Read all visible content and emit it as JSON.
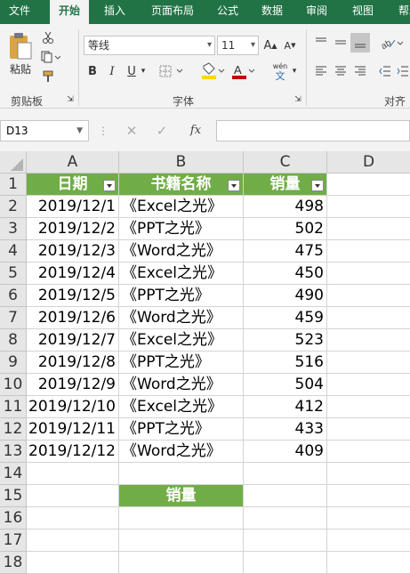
{
  "ribbon": {
    "tabs": [
      "文件",
      "开始",
      "插入",
      "页面布局",
      "公式",
      "数据",
      "审阅",
      "视图",
      "帮助"
    ],
    "active_tab": "开始",
    "clipboard": {
      "paste_label": "粘贴",
      "group_label": "剪贴板"
    },
    "font": {
      "name": "等线",
      "size": "11",
      "group_label": "字体",
      "grow": "A",
      "shrink": "A",
      "bold": "B",
      "italic": "I",
      "underline": "U",
      "wen": "wén",
      "wen2": "文"
    },
    "align": {
      "group_label": "对齐方"
    }
  },
  "formula_bar": {
    "name_box": "D13",
    "fx": "fx",
    "formula": ""
  },
  "columns": [
    "A",
    "B",
    "C",
    "D"
  ],
  "rows": [
    "1",
    "2",
    "3",
    "4",
    "5",
    "6",
    "7",
    "8",
    "9",
    "10",
    "11",
    "12",
    "13",
    "14",
    "15",
    "16",
    "17",
    "18"
  ],
  "table": {
    "headers": [
      "日期",
      "书籍名称",
      "销量"
    ],
    "rows": [
      [
        "2019/12/1",
        "《Excel之光》",
        "498"
      ],
      [
        "2019/12/2",
        "《PPT之光》",
        "502"
      ],
      [
        "2019/12/3",
        "《Word之光》",
        "475"
      ],
      [
        "2019/12/4",
        "《Excel之光》",
        "450"
      ],
      [
        "2019/12/5",
        "《PPT之光》",
        "490"
      ],
      [
        "2019/12/6",
        "《Word之光》",
        "459"
      ],
      [
        "2019/12/7",
        "《Excel之光》",
        "523"
      ],
      [
        "2019/12/8",
        "《PPT之光》",
        "516"
      ],
      [
        "2019/12/9",
        "《Word之光》",
        "504"
      ],
      [
        "2019/12/10",
        "《Excel之光》",
        "412"
      ],
      [
        "2019/12/11",
        "《PPT之光》",
        "433"
      ],
      [
        "2019/12/12",
        "《Word之光》",
        "409"
      ]
    ]
  },
  "summary_label": "销量",
  "colors": {
    "excel_green": "#217346",
    "header_fill": "#70ad47"
  }
}
